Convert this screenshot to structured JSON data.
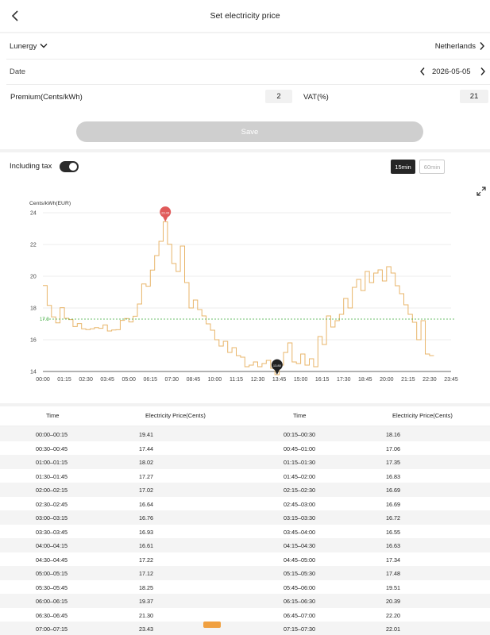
{
  "header": {
    "title": "Set electricity price"
  },
  "provider": {
    "name": "Lunergy",
    "country": "Netherlands"
  },
  "date": {
    "label": "Date",
    "value": "2026-05-05"
  },
  "premium": {
    "label": "Premium(Cents/kWh)",
    "value": "2"
  },
  "vat": {
    "label": "VAT(%)",
    "value": "21"
  },
  "save_label": "Save",
  "tax": {
    "label": "Including tax",
    "enabled": true
  },
  "interval": {
    "options": [
      "15min",
      "60min"
    ],
    "selected": "15min"
  },
  "colors": {
    "line": "#e8b56a",
    "avg": "#3caa3c",
    "max": "#e05a5a",
    "min": "#222222",
    "badge": "#f0a040"
  },
  "chart_data": {
    "type": "line",
    "ylabel": "Cents/kWh(EUR)",
    "ylim": [
      14,
      24
    ],
    "yticks": [
      14,
      16,
      18,
      20,
      22,
      24
    ],
    "xticks": [
      "00:00",
      "01:15",
      "02:30",
      "03:45",
      "05:00",
      "06:15",
      "07:30",
      "08:45",
      "10:00",
      "11:15",
      "12:30",
      "13:45",
      "15:00",
      "16:15",
      "17:30",
      "18:45",
      "20:00",
      "21:15",
      "22:30",
      "23:45"
    ],
    "average": 17.3,
    "average_label": "17.3",
    "max_label": "23.43",
    "min_label": "13.80",
    "values": [
      19.41,
      18.16,
      17.44,
      17.06,
      18.02,
      17.35,
      17.27,
      16.83,
      17.02,
      16.69,
      16.64,
      16.69,
      16.76,
      16.72,
      16.93,
      16.55,
      16.61,
      16.63,
      17.22,
      17.34,
      17.12,
      17.48,
      18.25,
      19.51,
      19.37,
      20.39,
      21.3,
      22.2,
      23.43,
      22.01,
      20.8,
      20.3,
      21.9,
      19.6,
      18.0,
      18.5,
      17.9,
      17.5,
      17.0,
      16.6,
      16.0,
      15.6,
      15.9,
      15.2,
      15.5,
      15.0,
      14.9,
      14.3,
      14.4,
      14.6,
      14.3,
      14.5,
      14.7,
      14.2,
      13.8,
      14.4,
      15.2,
      15.8,
      14.6,
      14.5,
      15.1,
      14.4,
      14.8,
      14.3,
      16.2,
      15.7,
      17.5,
      16.8,
      17.2,
      17.6,
      18.6,
      18.0,
      19.3,
      19.8,
      19.1,
      20.3,
      19.6,
      20.2,
      20.4,
      19.7,
      20.6,
      20.2,
      19.4,
      18.9,
      18.2,
      17.6,
      17.1,
      16.0,
      17.2,
      15.1,
      15.0
    ],
    "badge_value": "23.43"
  },
  "table": {
    "headers": {
      "time": "Time",
      "price": "Electricity Price(Cents)"
    },
    "rows": [
      [
        "00:00–00:15",
        "19.41",
        "00:15–00:30",
        "18.16"
      ],
      [
        "00:30–00:45",
        "17.44",
        "00:45–01:00",
        "17.06"
      ],
      [
        "01:00–01:15",
        "18.02",
        "01:15–01:30",
        "17.35"
      ],
      [
        "01:30–01:45",
        "17.27",
        "01:45–02:00",
        "16.83"
      ],
      [
        "02:00–02:15",
        "17.02",
        "02:15–02:30",
        "16.69"
      ],
      [
        "02:30–02:45",
        "16.64",
        "02:45–03:00",
        "16.69"
      ],
      [
        "03:00–03:15",
        "16.76",
        "03:15–03:30",
        "16.72"
      ],
      [
        "03:30–03:45",
        "16.93",
        "03:45–04:00",
        "16.55"
      ],
      [
        "04:00–04:15",
        "16.61",
        "04:15–04:30",
        "16.63"
      ],
      [
        "04:30–04:45",
        "17.22",
        "04:45–05:00",
        "17.34"
      ],
      [
        "05:00–05:15",
        "17.12",
        "05:15–05:30",
        "17.48"
      ],
      [
        "05:30–05:45",
        "18.25",
        "05:45–06:00",
        "19.51"
      ],
      [
        "06:00–06:15",
        "19.37",
        "06:15–06:30",
        "20.39"
      ],
      [
        "06:30–06:45",
        "21.30",
        "06:45–07:00",
        "22.20"
      ],
      [
        "07:00–07:15",
        "23.43",
        "07:15–07:30",
        "22.01"
      ]
    ]
  }
}
